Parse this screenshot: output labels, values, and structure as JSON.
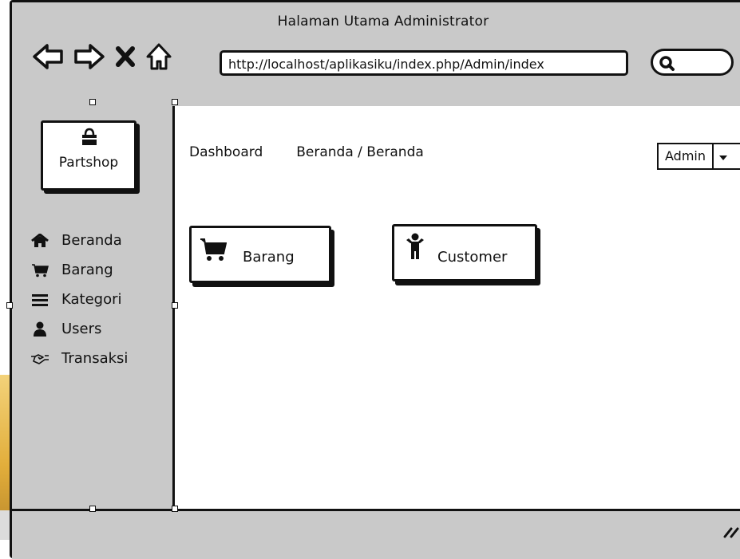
{
  "window": {
    "title": "Halaman Utama Administrator",
    "url": "http://localhost/aplikasiku/index.php/Admin/index",
    "nav_icons": [
      "back-arrow-icon",
      "forward-arrow-icon",
      "close-x-icon",
      "home-icon"
    ],
    "search_icon": "search-icon"
  },
  "sidebar": {
    "brand": {
      "name": "Partshop",
      "icon": "shopping-bag-icon"
    },
    "items": [
      {
        "label": "Beranda",
        "icon": "home-icon"
      },
      {
        "label": "Barang",
        "icon": "cart-icon"
      },
      {
        "label": "Kategori",
        "icon": "menu-lines-icon"
      },
      {
        "label": "Users",
        "icon": "user-icon"
      },
      {
        "label": "Transaksi",
        "icon": "handshake-icon"
      }
    ]
  },
  "header": {
    "title": "Dashboard",
    "breadcrumb": "Beranda / Beranda",
    "user_select": "Admin"
  },
  "cards": [
    {
      "label": "Barang",
      "icon": "cart-icon"
    },
    {
      "label": "Customer",
      "icon": "person-icon"
    }
  ],
  "colors": {
    "chrome": "#c9c9c9",
    "ink": "#111111",
    "content": "#ffffff"
  }
}
